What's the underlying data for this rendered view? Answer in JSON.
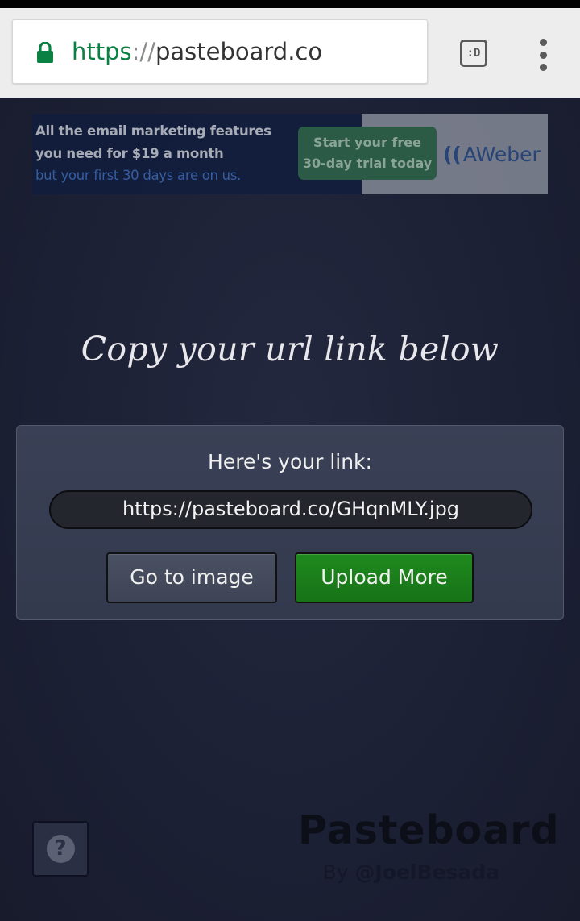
{
  "browser": {
    "url_scheme": "https",
    "url_separator": "://",
    "url_host": "pasteboard.co",
    "tabs_label": ":D",
    "lock_icon": "lock-icon",
    "menu_icon": "overflow-menu-icon",
    "colors": {
      "secure": "#0b8043"
    }
  },
  "ad": {
    "line1": "All the email marketing features",
    "line2": "you need for $19 a month",
    "line3": "but your first 30 days are on us.",
    "cta_line1": "Start your free",
    "cta_line2": "30-day trial today",
    "brand": "AWeber",
    "brand_mark": "(("
  },
  "page": {
    "heading": "Copy your url link below",
    "panel_label": "Here's your link:",
    "link_value": "https://pasteboard.co/GHqnMLY.jpg",
    "go_to_image_label": "Go to image",
    "upload_more_label": "Upload More",
    "help_label": "?",
    "help_icon": "question-circle-icon",
    "brand": "Pasteboard",
    "by_prefix": "By",
    "by_handle": "@JoelBesada",
    "colors": {
      "upload_button": "#1f8a1e",
      "background": "#1b1f33"
    }
  }
}
